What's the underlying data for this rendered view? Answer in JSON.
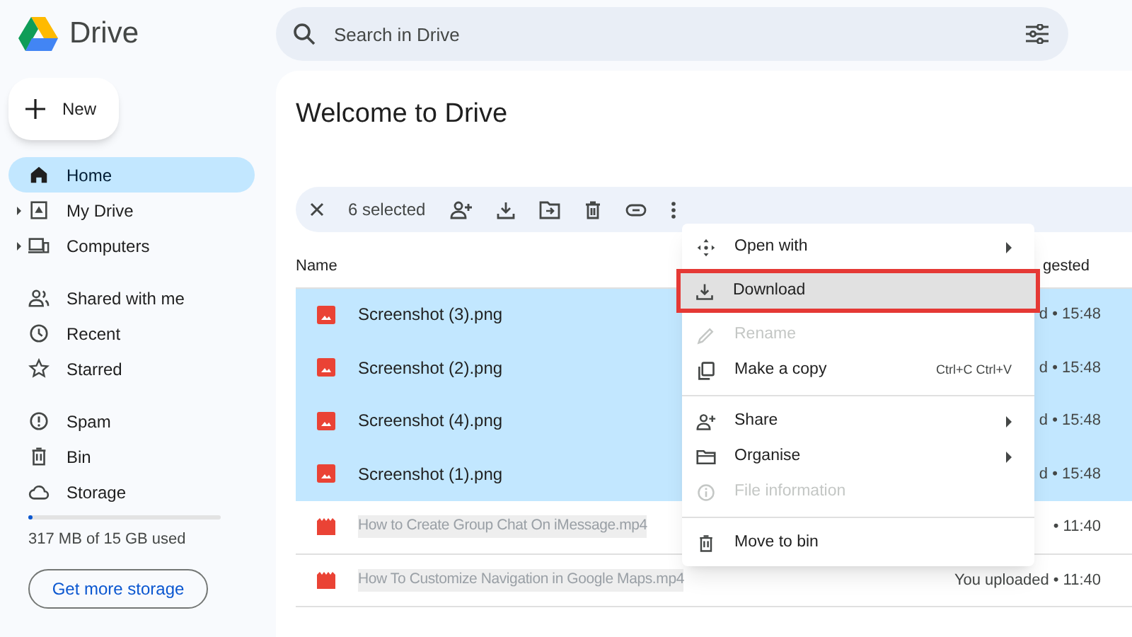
{
  "app": {
    "title": "Drive"
  },
  "search": {
    "placeholder": "Search in Drive"
  },
  "new_button": {
    "label": "New"
  },
  "sidebar": {
    "groups": [
      {
        "items": [
          {
            "label": "Home",
            "selected": true,
            "expandable": false
          },
          {
            "label": "My Drive",
            "selected": false,
            "expandable": true
          },
          {
            "label": "Computers",
            "selected": false,
            "expandable": true
          }
        ]
      },
      {
        "items": [
          {
            "label": "Shared with me",
            "selected": false,
            "expandable": false
          },
          {
            "label": "Recent",
            "selected": false,
            "expandable": false
          },
          {
            "label": "Starred",
            "selected": false,
            "expandable": false
          }
        ]
      },
      {
        "items": [
          {
            "label": "Spam",
            "selected": false,
            "expandable": false
          },
          {
            "label": "Bin",
            "selected": false,
            "expandable": false
          },
          {
            "label": "Storage",
            "selected": false,
            "expandable": false
          }
        ]
      }
    ]
  },
  "storage": {
    "level": 0.02,
    "text": "317 MB of 15 GB used",
    "button": "Get more storage"
  },
  "heading": "Welcome to Drive",
  "selection_bar": {
    "count": "6 selected"
  },
  "table": {
    "columns": [
      "Name",
      "gested"
    ],
    "rows": [
      {
        "name": "Screenshot (3).png",
        "kind": "image",
        "selected": true,
        "column_2": "d • 15:48"
      },
      {
        "name": "Screenshot (2).png",
        "kind": "image",
        "selected": true,
        "column_2": "d • 15:48"
      },
      {
        "name": "Screenshot (4).png",
        "kind": "image",
        "selected": true,
        "column_2": "d • 15:48"
      },
      {
        "name": "Screenshot (1).png",
        "kind": "image",
        "selected": true,
        "column_2": "d • 15:48"
      },
      {
        "name": "How to Create Group Chat On iMessage.mp4",
        "kind": "video",
        "selected": false,
        "column_2": "• 11:40"
      },
      {
        "name": "How To Customize Navigation in Google Maps.mp4",
        "kind": "video",
        "selected": false,
        "column_2": "You uploaded • 11:40"
      }
    ]
  },
  "context_menu": {
    "items": [
      {
        "kind": "item",
        "label": "Open with",
        "submenu": true,
        "disabled": false,
        "highlighted": false
      },
      {
        "kind": "item",
        "label": "Download",
        "submenu": false,
        "disabled": false,
        "highlighted": true
      },
      {
        "kind": "item",
        "label": "Rename",
        "submenu": false,
        "disabled": true,
        "highlighted": false
      },
      {
        "kind": "item",
        "label": "Make a copy",
        "shortcut": "Ctrl+C Ctrl+V",
        "submenu": false,
        "disabled": false,
        "highlighted": false
      },
      {
        "kind": "divider"
      },
      {
        "kind": "item",
        "label": "Share",
        "submenu": true,
        "disabled": false,
        "highlighted": false
      },
      {
        "kind": "item",
        "label": "Organise",
        "submenu": true,
        "disabled": false,
        "highlighted": false
      },
      {
        "kind": "item",
        "label": "File information",
        "submenu": false,
        "disabled": true,
        "highlighted": false
      },
      {
        "kind": "divider"
      },
      {
        "kind": "item",
        "label": "Move to bin",
        "submenu": false,
        "disabled": false,
        "highlighted": false
      }
    ]
  }
}
